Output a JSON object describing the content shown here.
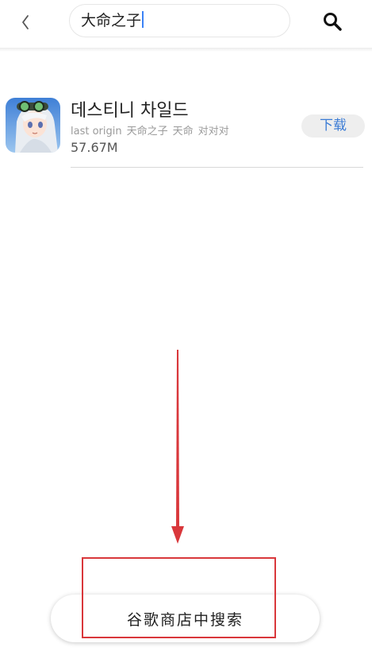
{
  "header": {
    "back_icon": "chevron-left-icon",
    "search_value": "大命之子",
    "search_icon": "search-icon"
  },
  "results": [
    {
      "title": "데스티니 차일드",
      "tags": [
        "last origin",
        "天命之子",
        "天命",
        "对对对"
      ],
      "size": "57.67M",
      "action_label": "下载",
      "icon": "app-icon-anime-girl"
    }
  ],
  "footer": {
    "google_play_search_label": "谷歌商店中搜索"
  },
  "colors": {
    "accent": "#3a7bd5",
    "annotation": "#d9373b",
    "caret": "#3b82f6"
  }
}
